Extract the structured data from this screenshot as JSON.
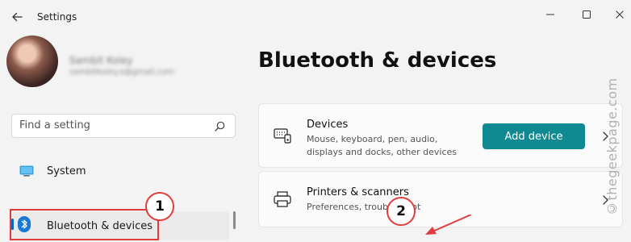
{
  "window": {
    "title": "Settings"
  },
  "profile": {
    "name": "Sambit Koley",
    "email": "sambitkoley.s@gmail.com"
  },
  "search": {
    "placeholder": "Find a setting"
  },
  "nav": {
    "items": [
      {
        "label": "System",
        "icon": "monitor-icon"
      },
      {
        "label": "Bluetooth & devices",
        "icon": "bluetooth-icon",
        "selected": true
      }
    ]
  },
  "main": {
    "title": "Bluetooth & devices",
    "cards": [
      {
        "title": "Devices",
        "description": [
          "Mouse, keyboard, pen, audio,",
          "displays and docks, other devices"
        ],
        "button_label": "Add device",
        "icon": "keyboard-devices-icon"
      },
      {
        "title": "Printers & scanners",
        "description": [
          "Preferences, troubleshoot"
        ],
        "icon": "printer-icon"
      }
    ]
  },
  "annotations": {
    "badge_1": "1",
    "badge_2": "2"
  },
  "watermark": "©thegeekpage.com",
  "colors": {
    "accent": "#0067c0",
    "button": "#0f8a93",
    "annotation": "#e23b3b"
  }
}
